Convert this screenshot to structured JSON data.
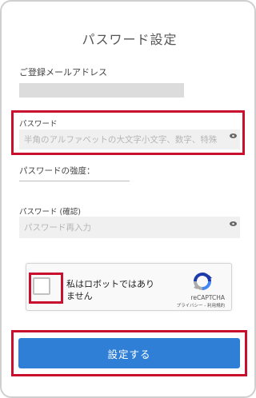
{
  "page": {
    "title": "パスワード設定"
  },
  "email": {
    "label": "ご登録メールアドレス"
  },
  "password": {
    "label": "パスワード",
    "placeholder": "半角のアルファベットの大文字小文字、数字、特殊"
  },
  "strength": {
    "label": "パスワードの強度："
  },
  "confirm": {
    "label": "パスワード (確認)",
    "placeholder": "パスワード再入力"
  },
  "captcha": {
    "text": "私はロボットではありません",
    "brand": "reCAPTCHA",
    "links": "プライバシー - 利用規約"
  },
  "submit": {
    "label": "設定する"
  },
  "colors": {
    "highlight": "#c8102e",
    "button": "#2f7fd6",
    "input_bg": "#f0f0f0"
  },
  "icons": {
    "visibility": "eye-icon",
    "captcha": "recaptcha-logo-icon"
  }
}
